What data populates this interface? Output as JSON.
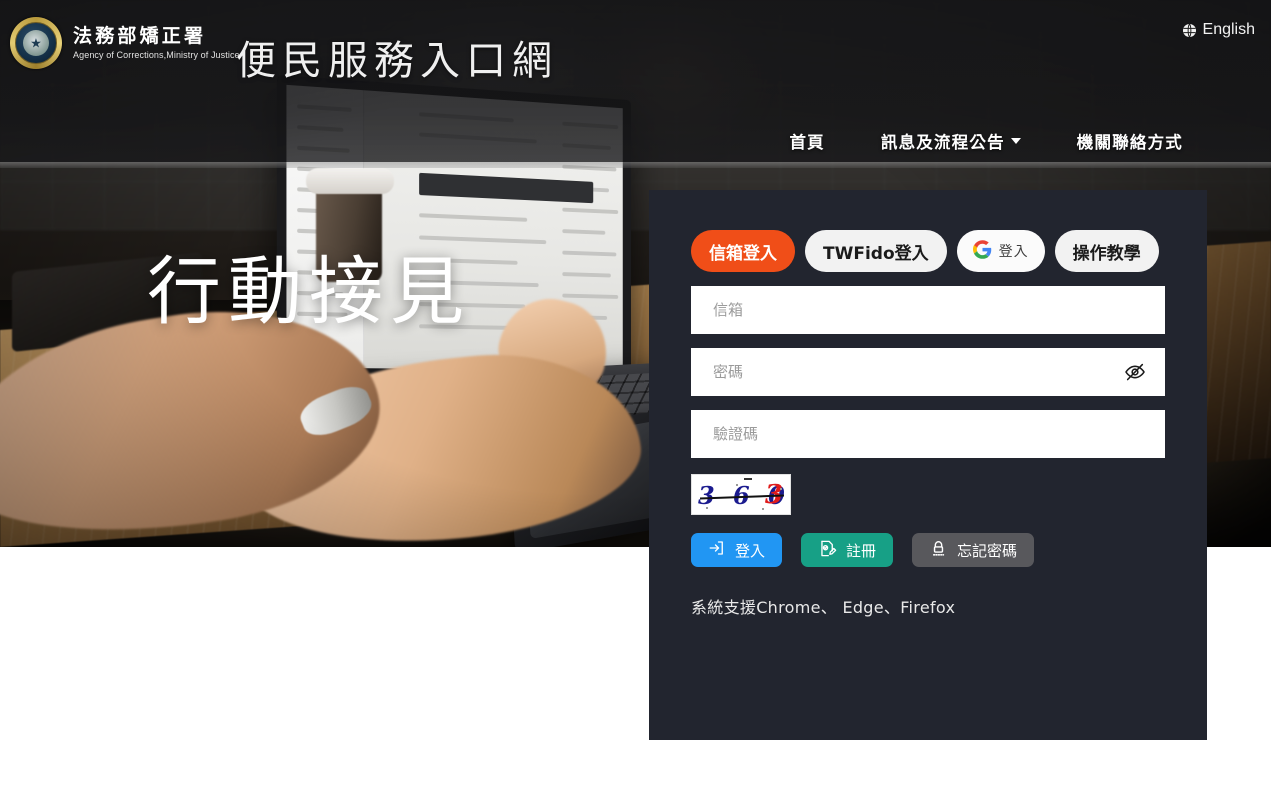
{
  "header": {
    "emblem_icon": "ministry-of-justice-emblem",
    "brand_cn": "法務部矯正署",
    "brand_en": "Agency of Corrections,Ministry of Justice",
    "site_title": "便民服務入口網",
    "language": {
      "icon": "globe-icon",
      "label": "English"
    },
    "nav": [
      {
        "label": "首頁",
        "has_dropdown": false
      },
      {
        "label": "訊息及流程公告",
        "has_dropdown": true
      },
      {
        "label": "機關聯絡方式",
        "has_dropdown": false
      }
    ]
  },
  "hero": {
    "headline": "行動接見"
  },
  "login": {
    "tabs": [
      {
        "label": "信箱登入",
        "state": "active",
        "icon": ""
      },
      {
        "label": "TWFido登入",
        "state": "inactive",
        "icon": ""
      },
      {
        "label": "登入",
        "state": "inactive",
        "icon": "google-icon"
      },
      {
        "label": "操作教學",
        "state": "inactive",
        "icon": ""
      }
    ],
    "fields": {
      "email": {
        "placeholder": "信箱",
        "value": ""
      },
      "password": {
        "placeholder": "密碼",
        "value": "",
        "toggle_icon": "eye-slash-icon"
      },
      "captcha": {
        "placeholder": "驗證碼",
        "value": ""
      }
    },
    "captcha_image": {
      "icon": "captcha-image",
      "text": "3603",
      "prefix": "3 6 0",
      "last_digit": "3",
      "prefix_color": "#1b1b8f",
      "last_digit_color": "#e01b1b"
    },
    "buttons": [
      {
        "label": "登入",
        "icon": "login-arrow-icon",
        "color": "#2196f3"
      },
      {
        "label": "註冊",
        "icon": "register-document-icon",
        "color": "#17a086"
      },
      {
        "label": "忘記密碼",
        "icon": "lock-password-icon",
        "color": "#58585c"
      }
    ],
    "support_note": "系統支援Chrome、 Edge、Firefox"
  },
  "colors": {
    "panel_bg": "#22252f",
    "accent_orange": "#f04e18",
    "login_blue": "#2196f3",
    "register_teal": "#17a086",
    "forgot_gray": "#58585c"
  }
}
